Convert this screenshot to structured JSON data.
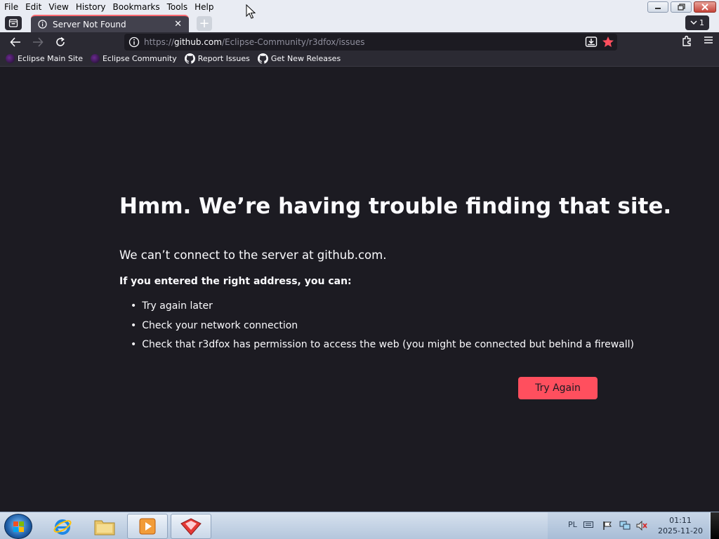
{
  "menubar": {
    "items": [
      {
        "label": "File"
      },
      {
        "label": "Edit"
      },
      {
        "label": "View"
      },
      {
        "label": "History"
      },
      {
        "label": "Bookmarks"
      },
      {
        "label": "Tools"
      },
      {
        "label": "Help"
      }
    ]
  },
  "tab": {
    "title": "Server Not Found",
    "close": "✕",
    "new_tab": "+",
    "count": "1"
  },
  "nav": {
    "url_prefix": "https://",
    "url_host": "github.com",
    "url_path": "/Eclipse-Community/r3dfox/issues"
  },
  "bookmarks": [
    {
      "label": "Eclipse Main Site",
      "icon": "eclipse-icon"
    },
    {
      "label": "Eclipse Community",
      "icon": "eclipse-icon"
    },
    {
      "label": "Report Issues",
      "icon": "github-icon"
    },
    {
      "label": "Get New Releases",
      "icon": "github-icon"
    }
  ],
  "error": {
    "title": "Hmm. We’re having trouble finding that site.",
    "description": "We can’t connect to the server at github.com.",
    "lead": "If you entered the right address, you can:",
    "suggestions": [
      "Try again later",
      "Check your network connection",
      "Check that r3dfox has permission to access the web (you might be connected but behind a firewall)"
    ],
    "button": "Try Again"
  },
  "taskbar": {
    "language": "PL",
    "time": "01:11",
    "date": "2025-11-20"
  },
  "colors": {
    "accent": "#ff4f5e",
    "page_background": "#1c1b22",
    "toolbar": "#2b2a33"
  }
}
